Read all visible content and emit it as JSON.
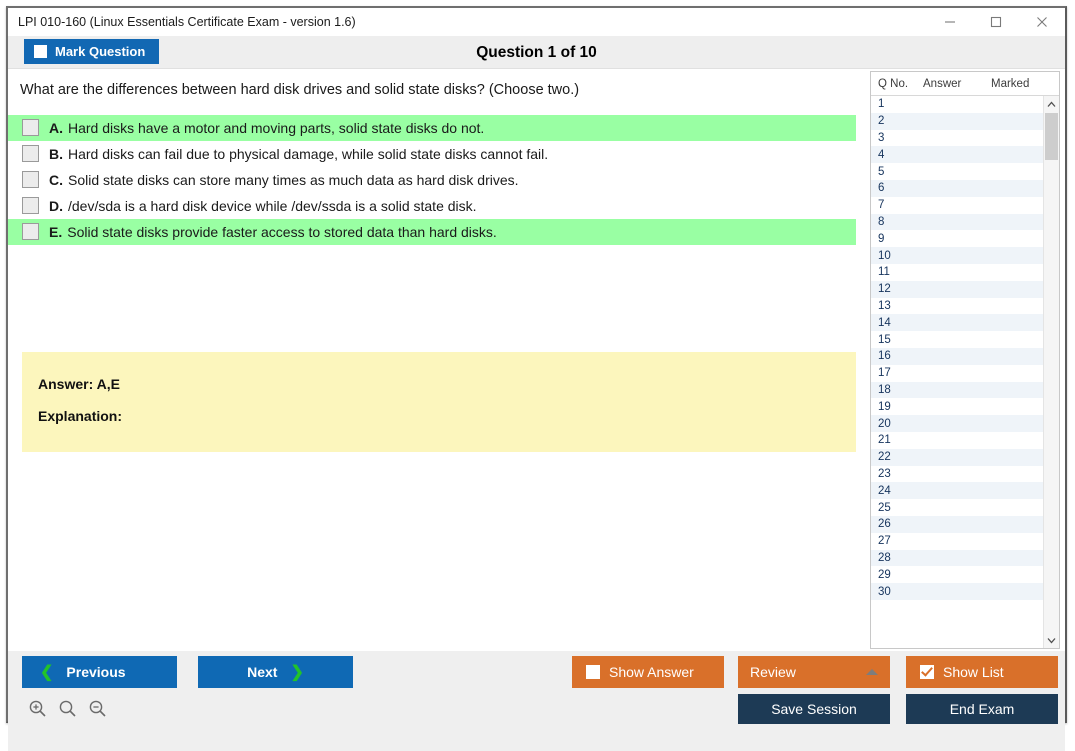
{
  "window": {
    "title": "LPI 010-160 (Linux Essentials Certificate Exam - version 1.6)",
    "controls": {
      "minimize": "minimize-icon",
      "maximize": "maximize-icon",
      "close": "close-icon"
    }
  },
  "header": {
    "mark_question_label": "Mark Question",
    "question_counter": "Question 1 of 10"
  },
  "question": {
    "text": "What are the differences between hard disk drives and solid state disks? (Choose two.)",
    "options": [
      {
        "letter": "A.",
        "text": "Hard disks have a motor and moving parts, solid state disks do not.",
        "highlight": true,
        "checked": false
      },
      {
        "letter": "B.",
        "text": "Hard disks can fail due to physical damage, while solid state disks cannot fail.",
        "highlight": false,
        "checked": false
      },
      {
        "letter": "C.",
        "text": "Solid state disks can store many times as much data as hard disk drives.",
        "highlight": false,
        "checked": false
      },
      {
        "letter": "D.",
        "text": "/dev/sda is a hard disk device while /dev/ssda is a solid state disk.",
        "highlight": false,
        "checked": false
      },
      {
        "letter": "E.",
        "text": "Solid state disks provide faster access to stored data than hard disks.",
        "highlight": true,
        "checked": false
      }
    ],
    "answer_label": "Answer: A,E",
    "explanation_label": "Explanation:"
  },
  "question_list": {
    "columns": [
      "Q No.",
      "Answer",
      "Marked"
    ],
    "rows": [
      {
        "no": "1",
        "answer": "",
        "marked": ""
      },
      {
        "no": "2",
        "answer": "",
        "marked": ""
      },
      {
        "no": "3",
        "answer": "",
        "marked": ""
      },
      {
        "no": "4",
        "answer": "",
        "marked": ""
      },
      {
        "no": "5",
        "answer": "",
        "marked": ""
      },
      {
        "no": "6",
        "answer": "",
        "marked": ""
      },
      {
        "no": "7",
        "answer": "",
        "marked": ""
      },
      {
        "no": "8",
        "answer": "",
        "marked": ""
      },
      {
        "no": "9",
        "answer": "",
        "marked": ""
      },
      {
        "no": "10",
        "answer": "",
        "marked": ""
      },
      {
        "no": "11",
        "answer": "",
        "marked": ""
      },
      {
        "no": "12",
        "answer": "",
        "marked": ""
      },
      {
        "no": "13",
        "answer": "",
        "marked": ""
      },
      {
        "no": "14",
        "answer": "",
        "marked": ""
      },
      {
        "no": "15",
        "answer": "",
        "marked": ""
      },
      {
        "no": "16",
        "answer": "",
        "marked": ""
      },
      {
        "no": "17",
        "answer": "",
        "marked": ""
      },
      {
        "no": "18",
        "answer": "",
        "marked": ""
      },
      {
        "no": "19",
        "answer": "",
        "marked": ""
      },
      {
        "no": "20",
        "answer": "",
        "marked": ""
      },
      {
        "no": "21",
        "answer": "",
        "marked": ""
      },
      {
        "no": "22",
        "answer": "",
        "marked": ""
      },
      {
        "no": "23",
        "answer": "",
        "marked": ""
      },
      {
        "no": "24",
        "answer": "",
        "marked": ""
      },
      {
        "no": "25",
        "answer": "",
        "marked": ""
      },
      {
        "no": "26",
        "answer": "",
        "marked": ""
      },
      {
        "no": "27",
        "answer": "",
        "marked": ""
      },
      {
        "no": "28",
        "answer": "",
        "marked": ""
      },
      {
        "no": "29",
        "answer": "",
        "marked": ""
      },
      {
        "no": "30",
        "answer": "",
        "marked": ""
      }
    ],
    "scrollbar": {
      "up": "scroll-up-icon",
      "down": "scroll-down-icon"
    }
  },
  "footer": {
    "previous_label": "Previous",
    "next_label": "Next",
    "show_answer_label": "Show Answer",
    "show_answer_checked": false,
    "review_label": "Review",
    "show_list_label": "Show List",
    "show_list_checked": true,
    "save_session_label": "Save Session",
    "end_exam_label": "End Exam",
    "zoom_in": "zoom-in-icon",
    "zoom_reset": "zoom-reset-icon",
    "zoom_out": "zoom-out-icon"
  },
  "colors": {
    "accent_blue": "#0f69b4",
    "accent_orange": "#d9702a",
    "accent_navy": "#1d3a55",
    "highlight_green": "#99ffa3",
    "answer_yellow": "#fcf6bd",
    "header_gray": "#eeeeee",
    "row_alt": "#eff4f9"
  }
}
